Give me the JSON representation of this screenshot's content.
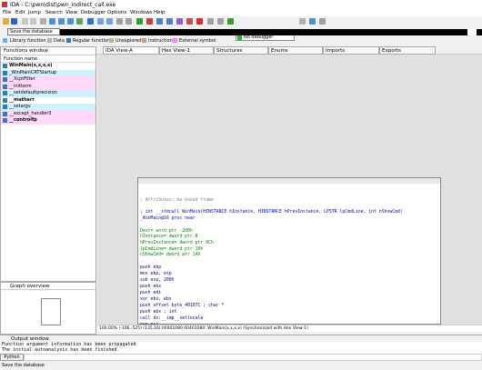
{
  "window": {
    "title": "IDA - C:\\pwn\\dist\\pwn_indirect_call.exe"
  },
  "menu": [
    "File",
    "Edit",
    "Jump",
    "Search",
    "View",
    "Debugger",
    "Options",
    "Windows",
    "Help"
  ],
  "toolbar": {
    "debugger": "No debugger"
  },
  "tooltip": "Save the database",
  "legend": [
    {
      "label": "Library function",
      "color": "#6ab0e4"
    },
    {
      "label": "Data",
      "color": "#b0b0b0"
    },
    {
      "label": "Regular function",
      "color": "#2a7cc8"
    },
    {
      "label": "Unexplored",
      "color": "#b5b58a"
    },
    {
      "label": "Instruction",
      "color": "#c0a080"
    },
    {
      "label": "External symbol",
      "color": "#ff80ff"
    }
  ],
  "tabs": [
    "IDA View-A",
    "Hex View-1",
    "Structures",
    "Enums",
    "Imports",
    "Exports"
  ],
  "functions_window": {
    "title": "Functions window",
    "column": "Function name",
    "items": [
      {
        "name": "WinMain(x,x,x,x)",
        "bold": true,
        "bg": "#ffffff"
      },
      {
        "name": "_WinMainCRTStartup",
        "bold": false,
        "bg": "#d0f0ff"
      },
      {
        "name": "__XcptFilter",
        "bold": false,
        "bg": "#ffd8f8"
      },
      {
        "name": "__initterm",
        "bold": false,
        "bg": "#ffd8f8"
      },
      {
        "name": "__setdefaultprecision",
        "bold": false,
        "bg": "#d0f0ff"
      },
      {
        "name": "__matherr",
        "bold": true,
        "bg": "#ffffff"
      },
      {
        "name": "__setargv",
        "bold": false,
        "bg": "#d0f0ff"
      },
      {
        "name": "__except_handler3",
        "bold": false,
        "bg": "#ffd8f8"
      },
      {
        "name": "__controlfp",
        "bold": true,
        "bg": "#ffd8f8"
      }
    ]
  },
  "graph_overview": {
    "title": "Graph overview"
  },
  "code_lines": [
    {
      "text": "; Attributes: bp-based frame",
      "color": "#7f7f7f"
    },
    {
      "text": "; int __stdcall WinMain(HINSTANCE hInstance, HINSTANCE hPrevInstance, LPSTR lpCmdLine, int nShowCmd)",
      "color": "#0000c0"
    },
    {
      "text": "_WinMain@16 proc near",
      "color": "#0000c0"
    },
    {
      "text": "Dest= word ptr -200h",
      "color": "#008000"
    },
    {
      "text": "hInstance= dword ptr  8",
      "color": "#008000"
    },
    {
      "text": "hPrevInstance= dword ptr  0Ch",
      "color": "#008000"
    },
    {
      "text": "lpCmdLine= dword ptr  10h",
      "color": "#008000"
    },
    {
      "text": "nShowCmd= dword ptr  14h",
      "color": "#008000"
    },
    {
      "text": "push    ebp",
      "color": "#000080"
    },
    {
      "text": "mov     ebp, esp",
      "color": "#000080"
    },
    {
      "text": "sub     esp, 200h",
      "color": "#000080"
    },
    {
      "text": "push    ebx",
      "color": "#000080"
    },
    {
      "text": "push    edi",
      "color": "#000080"
    },
    {
      "text": "xor     ebx, ebx",
      "color": "#000080"
    },
    {
      "text": "push    offset byte_40107C ; char *",
      "color": "#000080"
    },
    {
      "text": "push    ebx             ; int",
      "color": "#000080"
    },
    {
      "text": "call    ds:__imp__setlocale",
      "color": "#000080"
    },
    {
      "text": "pop     ecx",
      "color": "#000080"
    }
  ],
  "status_line": "100.00% (-106,-525) (135,16) 00001080 00401080: WinMain(x,x,x,x) (Synchronized with Hex View-1)",
  "output_window": {
    "title": "Output window",
    "lines": [
      "Function argument information has been propagated",
      "The initial autoanalysis has been finished."
    ]
  },
  "python_button": "Python",
  "status_bar": "Save the database"
}
